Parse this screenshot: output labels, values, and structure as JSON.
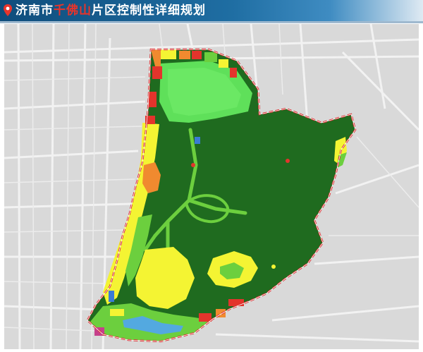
{
  "title": {
    "prefix": "济南市",
    "highlight": "千佛山",
    "suffix": "片区控制性详细规划",
    "highlight_color": "#e8342b",
    "bar_color": "#1a5f92"
  },
  "map": {
    "background_color": "#d9d9d9",
    "road_color": "#f2f2f2",
    "boundary_color": "#d8282a",
    "landuse_colors": {
      "park_green": "#1f6b1f",
      "green_space": "#6ccf3e",
      "park_light": "#5fe05a",
      "residential": "#f4f433",
      "commercial": "#e3342c",
      "education": "#f08a2f",
      "public_service": "#f0a030",
      "transport": "#3a7bd5",
      "water": "#53a9e0",
      "cultural": "#c6408a"
    },
    "icons": [
      "pin-icon"
    ]
  }
}
